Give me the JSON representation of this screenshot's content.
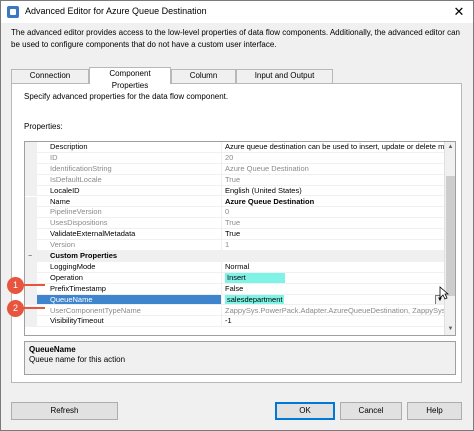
{
  "window": {
    "title": "Advanced Editor for Azure Queue Destination",
    "close_glyph": "✕"
  },
  "intro_text": "The advanced editor provides access to the low-level properties of data flow components. Additionally, the advanced editor can be used to configure components that do not have a custom user interface.",
  "tabs": [
    {
      "label": "Connection Managers"
    },
    {
      "label": "Component Properties"
    },
    {
      "label": "Column Mappings"
    },
    {
      "label": "Input and Output Properties"
    }
  ],
  "panel": {
    "description": "Specify advanced properties for the data flow component.",
    "properties_label": "Properties:"
  },
  "grid_rows": [
    {
      "name": "Description",
      "value": "Azure queue destination can be used to insert, update or delete m"
    },
    {
      "name": "ID",
      "value": "20"
    },
    {
      "name": "IdentificationString",
      "value": "Azure Queue Destination"
    },
    {
      "name": "IsDefaultLocale",
      "value": "True"
    },
    {
      "name": "LocaleID",
      "value": "English (United States)"
    },
    {
      "name": "Name",
      "value": "Azure Queue Destination"
    },
    {
      "name": "PipelineVersion",
      "value": "0"
    },
    {
      "name": "UsesDispositions",
      "value": "True"
    },
    {
      "name": "ValidateExternalMetadata",
      "value": "True"
    },
    {
      "name": "Version",
      "value": "1"
    },
    {
      "name": "Custom Properties",
      "value": ""
    },
    {
      "name": "LoggingMode",
      "value": "Normal"
    },
    {
      "name": "Operation",
      "value": "Insert"
    },
    {
      "name": "PrefixTimestamp",
      "value": "False"
    },
    {
      "name": "QueueName",
      "value": "salesdepartment"
    },
    {
      "name": "UserComponentTypeName",
      "value": "ZappySys.PowerPack.Adapter.AzureQueueDestination, ZappySys.PowerPack"
    },
    {
      "name": "VisibilityTimeout",
      "value": "-1"
    }
  ],
  "description_box": {
    "title": "QueueName",
    "text": "Queue name for this action"
  },
  "callouts": [
    "1",
    "2"
  ],
  "buttons": {
    "refresh": "Refresh",
    "ok": "OK",
    "cancel": "Cancel",
    "help": "Help"
  },
  "colors": {
    "highlight": "#7ff3e5",
    "selection": "#3f85cd",
    "callout": "#e8553f",
    "ok_border": "#0078d7"
  },
  "icons": {
    "app": "app-icon",
    "close": "close-icon",
    "dropdown": "chevron-down-icon",
    "collapse": "minus-icon"
  }
}
